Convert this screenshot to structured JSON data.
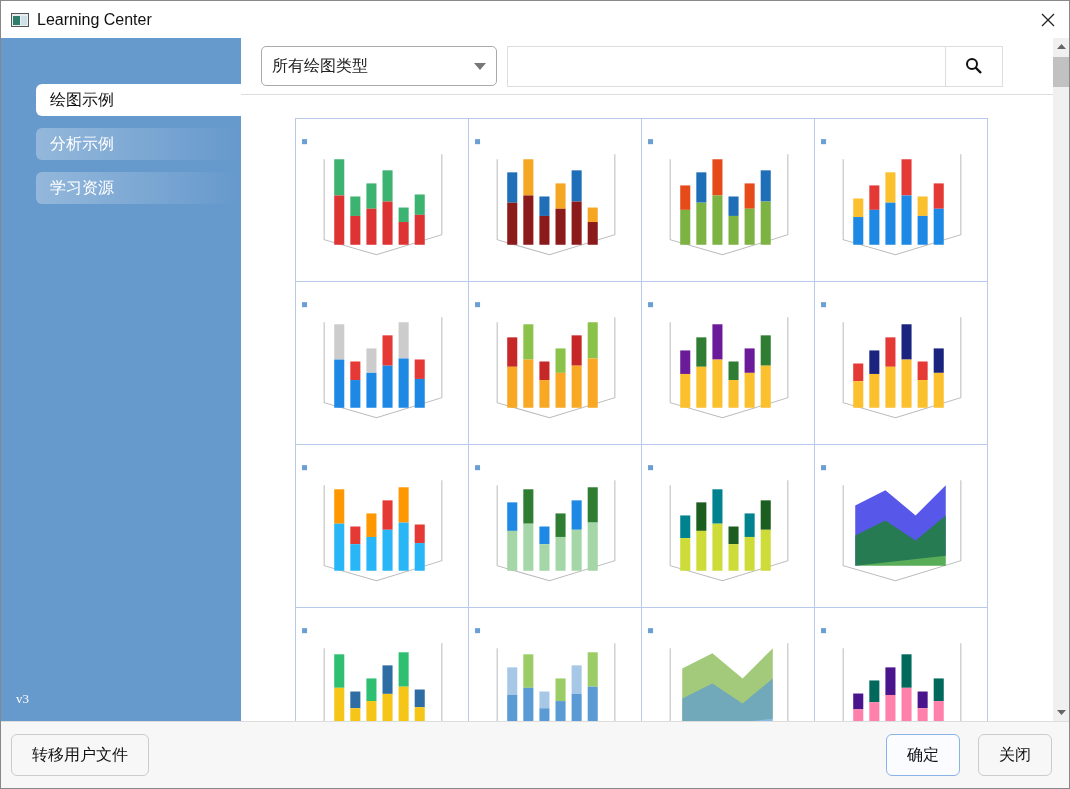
{
  "window": {
    "title": "Learning Center"
  },
  "sidebar": {
    "items": [
      {
        "label": "绘图示例",
        "selected": true
      },
      {
        "label": "分析示例",
        "selected": false
      },
      {
        "label": "学习资源",
        "selected": false
      }
    ],
    "version": "v3"
  },
  "filter": {
    "value": "所有绘图类型"
  },
  "footer": {
    "left_button": "转移用户文件",
    "buttons": [
      {
        "label": "确定",
        "default": true
      },
      {
        "label": "关闭",
        "default": false
      }
    ]
  }
}
